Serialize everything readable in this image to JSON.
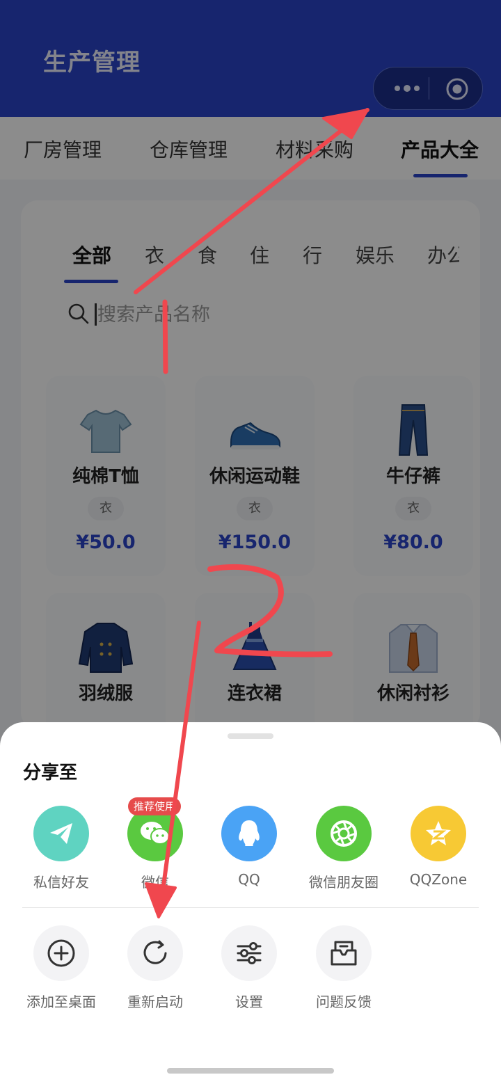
{
  "header": {
    "title": "生产管理"
  },
  "capsule": {
    "more_icon": "more-dots-icon",
    "close_icon": "target-circle-icon"
  },
  "top_tabs": [
    {
      "label": "厂房管理",
      "active": false
    },
    {
      "label": "仓库管理",
      "active": false
    },
    {
      "label": "材料采购",
      "active": false
    },
    {
      "label": "产品大全",
      "active": true
    }
  ],
  "categories": [
    "全部",
    "衣",
    "食",
    "住",
    "行",
    "娱乐",
    "办公"
  ],
  "search": {
    "placeholder": "搜索产品名称"
  },
  "products": [
    {
      "name": "纯棉T恤",
      "tag": "衣",
      "price": "¥50.0",
      "icon": "tshirt-icon"
    },
    {
      "name": "休闲运动鞋",
      "tag": "衣",
      "price": "¥150.0",
      "icon": "sneaker-icon"
    },
    {
      "name": "牛仔裤",
      "tag": "衣",
      "price": "¥80.0",
      "icon": "jeans-icon"
    },
    {
      "name": "羽绒服",
      "tag": "",
      "price": "",
      "icon": "coat-icon"
    },
    {
      "name": "连衣裙",
      "tag": "",
      "price": "",
      "icon": "dress-icon"
    },
    {
      "name": "休闲衬衫",
      "tag": "",
      "price": "",
      "icon": "shirt-tie-icon"
    }
  ],
  "share_sheet": {
    "title": "分享至",
    "badge": "推荐使用",
    "share_items": [
      {
        "label": "私信好友",
        "icon": "paper-plane-icon",
        "color": "#5fd3c1"
      },
      {
        "label": "微信",
        "icon": "wechat-icon",
        "color": "#5ac940"
      },
      {
        "label": "QQ",
        "icon": "qq-icon",
        "color": "#4aa3f5"
      },
      {
        "label": "微信朋友圈",
        "icon": "moments-icon",
        "color": "#5ac940"
      },
      {
        "label": "QQZone",
        "icon": "qzone-icon",
        "color": "#f7c934"
      }
    ],
    "actions": [
      {
        "label": "添加至桌面",
        "icon": "add-icon"
      },
      {
        "label": "重新启动",
        "icon": "restart-icon"
      },
      {
        "label": "设置",
        "icon": "sliders-icon"
      },
      {
        "label": "问题反馈",
        "icon": "feedback-icon"
      }
    ]
  },
  "annotations": {
    "step1": "1",
    "step2": "2",
    "color": "#f0474e"
  },
  "colors": {
    "primary": "#2a44c8"
  }
}
